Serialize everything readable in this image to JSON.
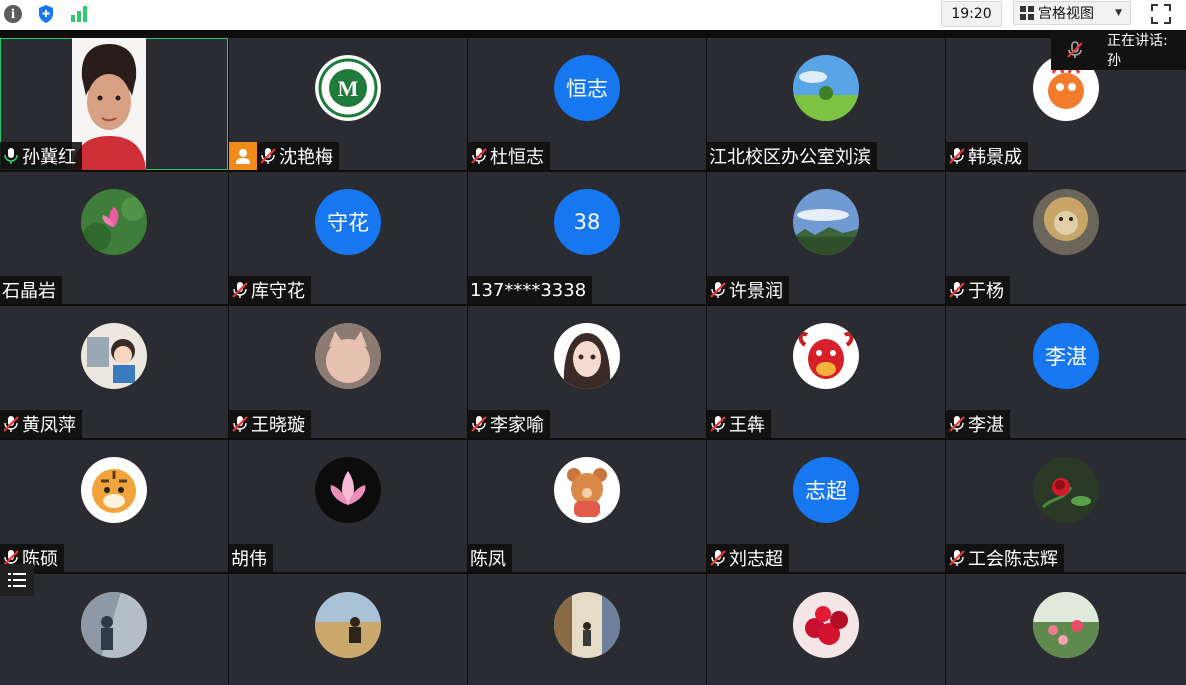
{
  "toolbar": {
    "info_icon": "info-icon",
    "shield_icon": "shield-icon",
    "signal_icon": "signal-icon",
    "time": "19:20",
    "view_label": "宫格视图",
    "fullscreen_icon": "fullscreen-icon"
  },
  "speaker_indicator": {
    "label": "正在讲话: 孙"
  },
  "colors": {
    "avatar_blue": "#1677f0",
    "speaking_border": "#2ec96a",
    "host_badge": "#f08a1a",
    "tile_bg": "#2b2c31"
  },
  "participants": [
    {
      "name": "孙冀红",
      "mic": "on",
      "avatar": "video",
      "speaking": true
    },
    {
      "name": "沈艳梅",
      "mic": "off",
      "avatar": "school-logo",
      "host": true
    },
    {
      "name": "杜恒志",
      "mic": "off",
      "avatar_text": "恒志"
    },
    {
      "name": "江北校区办公室刘滨",
      "mic": "none",
      "avatar": "meadow"
    },
    {
      "name": "韩景成",
      "mic": "off",
      "avatar": "dragon"
    },
    {
      "name": "石晶岩",
      "mic": "none",
      "avatar": "lotus-pond"
    },
    {
      "name": "库守花",
      "mic": "off",
      "avatar_text": "守花"
    },
    {
      "name": "137****3338",
      "mic": "none",
      "avatar_text": "38"
    },
    {
      "name": "许景润",
      "mic": "off",
      "avatar": "sky"
    },
    {
      "name": "于杨",
      "mic": "off",
      "avatar": "lion"
    },
    {
      "name": "黄凤萍",
      "mic": "off",
      "avatar": "cartoon-girl"
    },
    {
      "name": "王晓璇",
      "mic": "off",
      "avatar": "cat"
    },
    {
      "name": "李家喻",
      "mic": "off",
      "avatar": "anime-girl"
    },
    {
      "name": "王犇",
      "mic": "off",
      "avatar": "ox"
    },
    {
      "name": "李湛",
      "mic": "off",
      "avatar_text": "李湛"
    },
    {
      "name": "陈硕",
      "mic": "off",
      "avatar": "tiger"
    },
    {
      "name": "胡伟",
      "mic": "none",
      "avatar": "lotus-flower"
    },
    {
      "name": "陈凤",
      "mic": "none",
      "avatar": "bear"
    },
    {
      "name": "刘志超",
      "mic": "off",
      "avatar_text": "志超"
    },
    {
      "name": "工会陈志辉",
      "mic": "off",
      "avatar": "rose"
    },
    {
      "name": "",
      "mic": "none",
      "avatar": "photo-wall"
    },
    {
      "name": "",
      "mic": "none",
      "avatar": "photo-person"
    },
    {
      "name": "",
      "mic": "none",
      "avatar": "photo-street"
    },
    {
      "name": "",
      "mic": "none",
      "avatar": "cherries"
    },
    {
      "name": "",
      "mic": "none",
      "avatar": "flowers"
    }
  ],
  "list_button_icon": "list-icon"
}
